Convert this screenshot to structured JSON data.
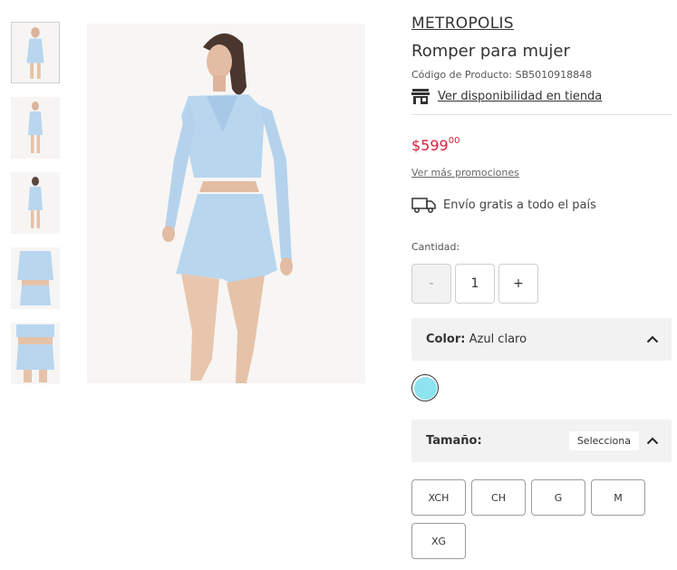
{
  "thumbnails": [
    "thumbnail-1",
    "thumbnail-2",
    "thumbnail-3",
    "thumbnail-4",
    "thumbnail-5"
  ],
  "product": {
    "brand": "METROPOLIS",
    "title": "Romper para mujer",
    "code_label": "Código de Producto: SB5010918848",
    "availability_link": "Ver disponibilidad en tienda",
    "price_main": "$599",
    "price_cents": "00",
    "promos_link": "Ver más promociones",
    "shipping_text": "Envío gratis a todo el país"
  },
  "quantity": {
    "label": "Cantidad:",
    "minus": "-",
    "value": "1",
    "plus": "+"
  },
  "color": {
    "label": "Color:",
    "value": "Azul claro",
    "swatch_hex": "#8de3ef"
  },
  "size": {
    "label": "Tamaño:",
    "select_text": "Selecciona",
    "options": [
      "XCH",
      "CH",
      "G",
      "M",
      "XG"
    ]
  },
  "colors": {
    "price": "#d8203c",
    "garment": "#b9d6ef",
    "accordion_bg": "#f2f2f2"
  },
  "icons": {
    "store": "store-icon",
    "truck": "truck-icon",
    "chevron": "chevron-up-icon"
  }
}
